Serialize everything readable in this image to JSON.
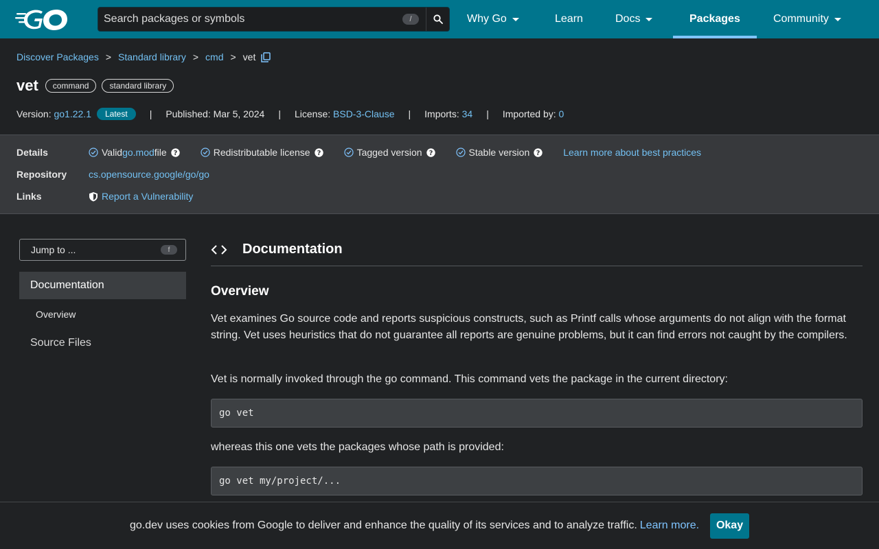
{
  "header": {
    "search_placeholder": "Search packages or symbols",
    "search_shortcut": "/",
    "nav": [
      {
        "label": "Why Go",
        "dropdown": true
      },
      {
        "label": "Learn",
        "dropdown": false
      },
      {
        "label": "Docs",
        "dropdown": true
      },
      {
        "label": "Packages",
        "dropdown": false,
        "active": true
      },
      {
        "label": "Community",
        "dropdown": true
      }
    ]
  },
  "breadcrumb": {
    "items": [
      "Discover Packages",
      "Standard library",
      "cmd"
    ],
    "current": "vet",
    "separator": ">"
  },
  "package": {
    "title": "vet",
    "chips": [
      "command",
      "standard library"
    ],
    "meta": {
      "version_label": "Version:",
      "version": "go1.22.1",
      "latest_badge": "Latest",
      "published_label": "Published:",
      "published": "Mar 5, 2024",
      "license_label": "License:",
      "license": "BSD-3-Clause",
      "imports_label": "Imports:",
      "imports": "34",
      "imported_by_label": "Imported by:",
      "imported_by": "0",
      "separator": "|"
    }
  },
  "details": {
    "details_label": "Details",
    "checks": [
      {
        "pre": "Valid ",
        "link": "go.mod",
        "post": " file"
      },
      {
        "pre": "Redistributable license",
        "link": "",
        "post": ""
      },
      {
        "pre": "Tagged version",
        "link": "",
        "post": ""
      },
      {
        "pre": "Stable version",
        "link": "",
        "post": ""
      }
    ],
    "best_practices_link": "Learn more about best practices",
    "repository_label": "Repository",
    "repository": "cs.opensource.google/go/go",
    "links_label": "Links",
    "vuln_link": "Report a Vulnerability"
  },
  "sidebar": {
    "jump_label": "Jump to ...",
    "jump_shortcut": "f",
    "documentation": "Documentation",
    "overview": "Overview",
    "source_files": "Source Files"
  },
  "main": {
    "section_title": "Documentation",
    "overview_title": "Overview",
    "para1": "Vet examines Go source code and reports suspicious constructs, such as Printf calls whose arguments do not align with the format string. Vet uses heuristics that do not guarantee all reports are genuine problems, but it can find errors not caught by the compilers.",
    "para2": "Vet is normally invoked through the go command. This command vets the package in the current directory:",
    "code1": "go vet",
    "para3": "whereas this one vets the packages whose path is provided:",
    "code2": "go vet my/project/..."
  },
  "cookie": {
    "text": "go.dev uses cookies from Google to deliver and enhance the quality of its services and to analyze traffic.",
    "link": "Learn more.",
    "button": "Okay"
  },
  "colors": {
    "header_bg": "#00758d",
    "link": "#7fc4ff",
    "page_bg": "#202224"
  }
}
